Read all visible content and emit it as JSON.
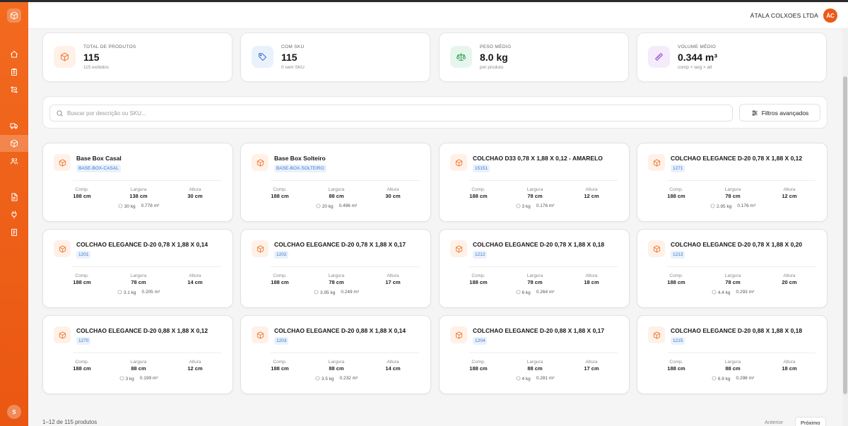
{
  "header": {
    "company": "ÁTALA COLXOES LTDA",
    "avatar_initials": "ÁC"
  },
  "sidebar": {
    "logo_icon": "package-icon",
    "items": [
      {
        "icon": "home-icon",
        "active": false
      },
      {
        "icon": "clipboard-icon",
        "active": false
      },
      {
        "icon": "route-icon",
        "active": false
      },
      {
        "icon": "truck-icon",
        "active": false
      },
      {
        "icon": "package-icon",
        "active": true
      },
      {
        "icon": "users-icon",
        "active": false
      },
      {
        "icon": "file-icon",
        "active": false
      },
      {
        "icon": "plug-icon",
        "active": false
      },
      {
        "icon": "receipt-icon",
        "active": false
      }
    ],
    "user_initial": "S"
  },
  "stats": [
    {
      "label": "TOTAL DE PRODUTOS",
      "value": "115",
      "sub": "115 exibidos",
      "icon": "package-icon",
      "color": "#f07a34",
      "bg": "#fff1e8"
    },
    {
      "label": "COM SKU",
      "value": "115",
      "sub": "0 sem SKU",
      "icon": "tag-icon",
      "color": "#3a78cf",
      "bg": "#e9f1fc"
    },
    {
      "label": "PESO MÉDIO",
      "value": "8.0 kg",
      "sub": "por produto",
      "icon": "scale-icon",
      "color": "#2f9e55",
      "bg": "#e7f6ec"
    },
    {
      "label": "VOLUME MÉDIO",
      "value": "0.344 m³",
      "sub": "comp × larg × alt",
      "icon": "ruler-icon",
      "color": "#9b4fd6",
      "bg": "#f4ebfb"
    }
  ],
  "search": {
    "placeholder": "Buscar por descrição ou SKU..."
  },
  "filters": {
    "label": "Filtros avançados"
  },
  "dim_labels": {
    "comp": "Comp.",
    "larg": "Largura",
    "alt": "Altura"
  },
  "products": [
    {
      "name": "Base Box Casal",
      "sku": "BASE-BOX-CASAL",
      "comp": "188 cm",
      "larg": "138 cm",
      "alt": "30 cm",
      "weight": "30 kg",
      "volume": "0.778 m³"
    },
    {
      "name": "Base Box Solteiro",
      "sku": "BASE-BOX-SOLTEIRO",
      "comp": "188 cm",
      "larg": "88 cm",
      "alt": "30 cm",
      "weight": "20 kg",
      "volume": "0.496 m³"
    },
    {
      "name": "COLCHAO D33 0,78 X 1,88 X 0,12 - AMARELO",
      "sku": "15151",
      "comp": "188 cm",
      "larg": "78 cm",
      "alt": "12 cm",
      "weight": "3 kg",
      "volume": "0.176 m³"
    },
    {
      "name": "COLCHAO ELEGANCE D-20 0,78 X 1,88 X 0,12",
      "sku": "1271",
      "comp": "188 cm",
      "larg": "78 cm",
      "alt": "12 cm",
      "weight": "2.95 kg",
      "volume": "0.176 m³"
    },
    {
      "name": "COLCHAO ELEGANCE D-20 0,78 X 1,88 X 0,14",
      "sku": "1201",
      "comp": "188 cm",
      "larg": "78 cm",
      "alt": "14 cm",
      "weight": "3.1 kg",
      "volume": "0.205 m³"
    },
    {
      "name": "COLCHAO ELEGANCE D-20 0,78 X 1,88 X 0,17",
      "sku": "1202",
      "comp": "188 cm",
      "larg": "78 cm",
      "alt": "17 cm",
      "weight": "3.95 kg",
      "volume": "0.249 m³"
    },
    {
      "name": "COLCHAO ELEGANCE D-20 0,78 X 1,88 X 0,18",
      "sku": "1212",
      "comp": "188 cm",
      "larg": "78 cm",
      "alt": "18 cm",
      "weight": "6 kg",
      "volume": "0.264 m³"
    },
    {
      "name": "COLCHAO ELEGANCE D-20 0,78 X 1,88 X 0,20",
      "sku": "1213",
      "comp": "188 cm",
      "larg": "78 cm",
      "alt": "20 cm",
      "weight": "4.4 kg",
      "volume": "0.293 m³"
    },
    {
      "name": "COLCHAO ELEGANCE D-20 0,88 X 1,88 X 0,12",
      "sku": "1270",
      "comp": "188 cm",
      "larg": "88 cm",
      "alt": "12 cm",
      "weight": "3 kg",
      "volume": "0.199 m³"
    },
    {
      "name": "COLCHAO ELEGANCE D-20 0,88 X 1,88 X 0,14",
      "sku": "1203",
      "comp": "188 cm",
      "larg": "88 cm",
      "alt": "14 cm",
      "weight": "3.5 kg",
      "volume": "0.232 m³"
    },
    {
      "name": "COLCHAO ELEGANCE D-20 0,88 X 1,88 X 0,17",
      "sku": "1204",
      "comp": "188 cm",
      "larg": "88 cm",
      "alt": "17 cm",
      "weight": "4 kg",
      "volume": "0.281 m³"
    },
    {
      "name": "COLCHAO ELEGANCE D-20 0,88 X 1,88 X 0,18",
      "sku": "1215",
      "comp": "188 cm",
      "larg": "88 cm",
      "alt": "18 cm",
      "weight": "6.9 kg",
      "volume": "0.298 m³"
    }
  ],
  "pagination": {
    "summary": "1–12 de 115 produtos",
    "prev": "Anterior",
    "next": "Próximo"
  }
}
